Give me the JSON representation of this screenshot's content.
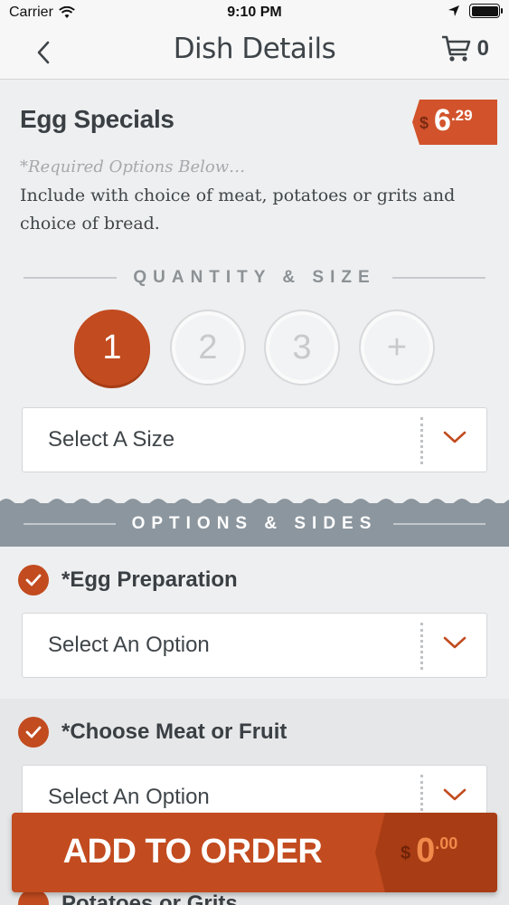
{
  "status_bar": {
    "carrier": "Carrier",
    "time": "9:10 PM"
  },
  "nav": {
    "title": "Dish Details",
    "cart_count": "0"
  },
  "dish": {
    "name": "Egg Specials",
    "price_dollar": "$",
    "price_whole": "6",
    "price_cents": ".29",
    "required_note": "*Required Options Below…",
    "description": "Include with choice of meat, potatoes or grits and choice of bread."
  },
  "quantity": {
    "header": "QUANTITY & SIZE",
    "options": [
      "1",
      "2",
      "3",
      "+"
    ],
    "selected": "1"
  },
  "size_select": {
    "value": "Select A Size"
  },
  "options_section": {
    "header": "OPTIONS & SIDES"
  },
  "options": [
    {
      "title": "*Egg Preparation",
      "value": "Select An Option"
    },
    {
      "title": "*Choose Meat or Fruit",
      "value": "Select An Option"
    },
    {
      "title": "Potatoes or Grits"
    }
  ],
  "add_to_order": {
    "label": "ADD TO ORDER",
    "dollar": "$",
    "whole": "0",
    "cents": ".00"
  },
  "colors": {
    "accent": "#c24b1f",
    "band": "#8c969e",
    "price_tag": "#d2532b"
  }
}
